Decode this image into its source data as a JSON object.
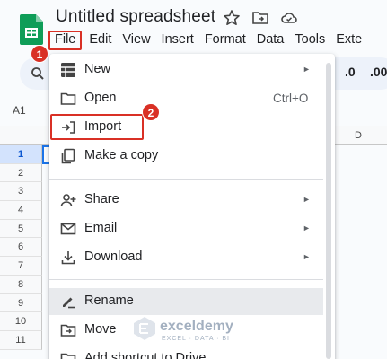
{
  "app": {
    "doc_title": "Untitled spreadsheet"
  },
  "menubar": [
    "File",
    "Edit",
    "View",
    "Insert",
    "Format",
    "Data",
    "Tools",
    "Exte"
  ],
  "toolbar": {
    "decrease_decimal": ".0",
    "increase_decimal": ".00"
  },
  "grid": {
    "name_box": "A1",
    "column_visible": "D",
    "rows": [
      "1",
      "2",
      "3",
      "4",
      "5",
      "6",
      "7",
      "8",
      "9",
      "10",
      "11"
    ]
  },
  "file_menu": {
    "items": [
      {
        "label": "New",
        "icon": "new-sheet-icon",
        "submenu": true
      },
      {
        "label": "Open",
        "icon": "folder-icon",
        "shortcut": "Ctrl+O"
      },
      {
        "label": "Import",
        "icon": "import-icon"
      },
      {
        "label": "Make a copy",
        "icon": "copy-icon"
      },
      {
        "label": "Share",
        "icon": "share-person-icon",
        "submenu": true
      },
      {
        "label": "Email",
        "icon": "email-icon",
        "submenu": true
      },
      {
        "label": "Download",
        "icon": "download-icon",
        "submenu": true
      },
      {
        "label": "Rename",
        "icon": "rename-pencil-icon"
      },
      {
        "label": "Move",
        "icon": "move-folder-icon"
      },
      {
        "label": "Add shortcut to Drive",
        "icon": "drive-shortcut-icon"
      }
    ]
  },
  "annotations": {
    "step1": "1",
    "step2": "2"
  },
  "watermark": {
    "name": "exceldemy",
    "tagline": "EXCEL · DATA · BI"
  },
  "colors": {
    "accent_red": "#d93025",
    "sheets_green": "#0f9d58",
    "selection_blue": "#1a73e8"
  }
}
